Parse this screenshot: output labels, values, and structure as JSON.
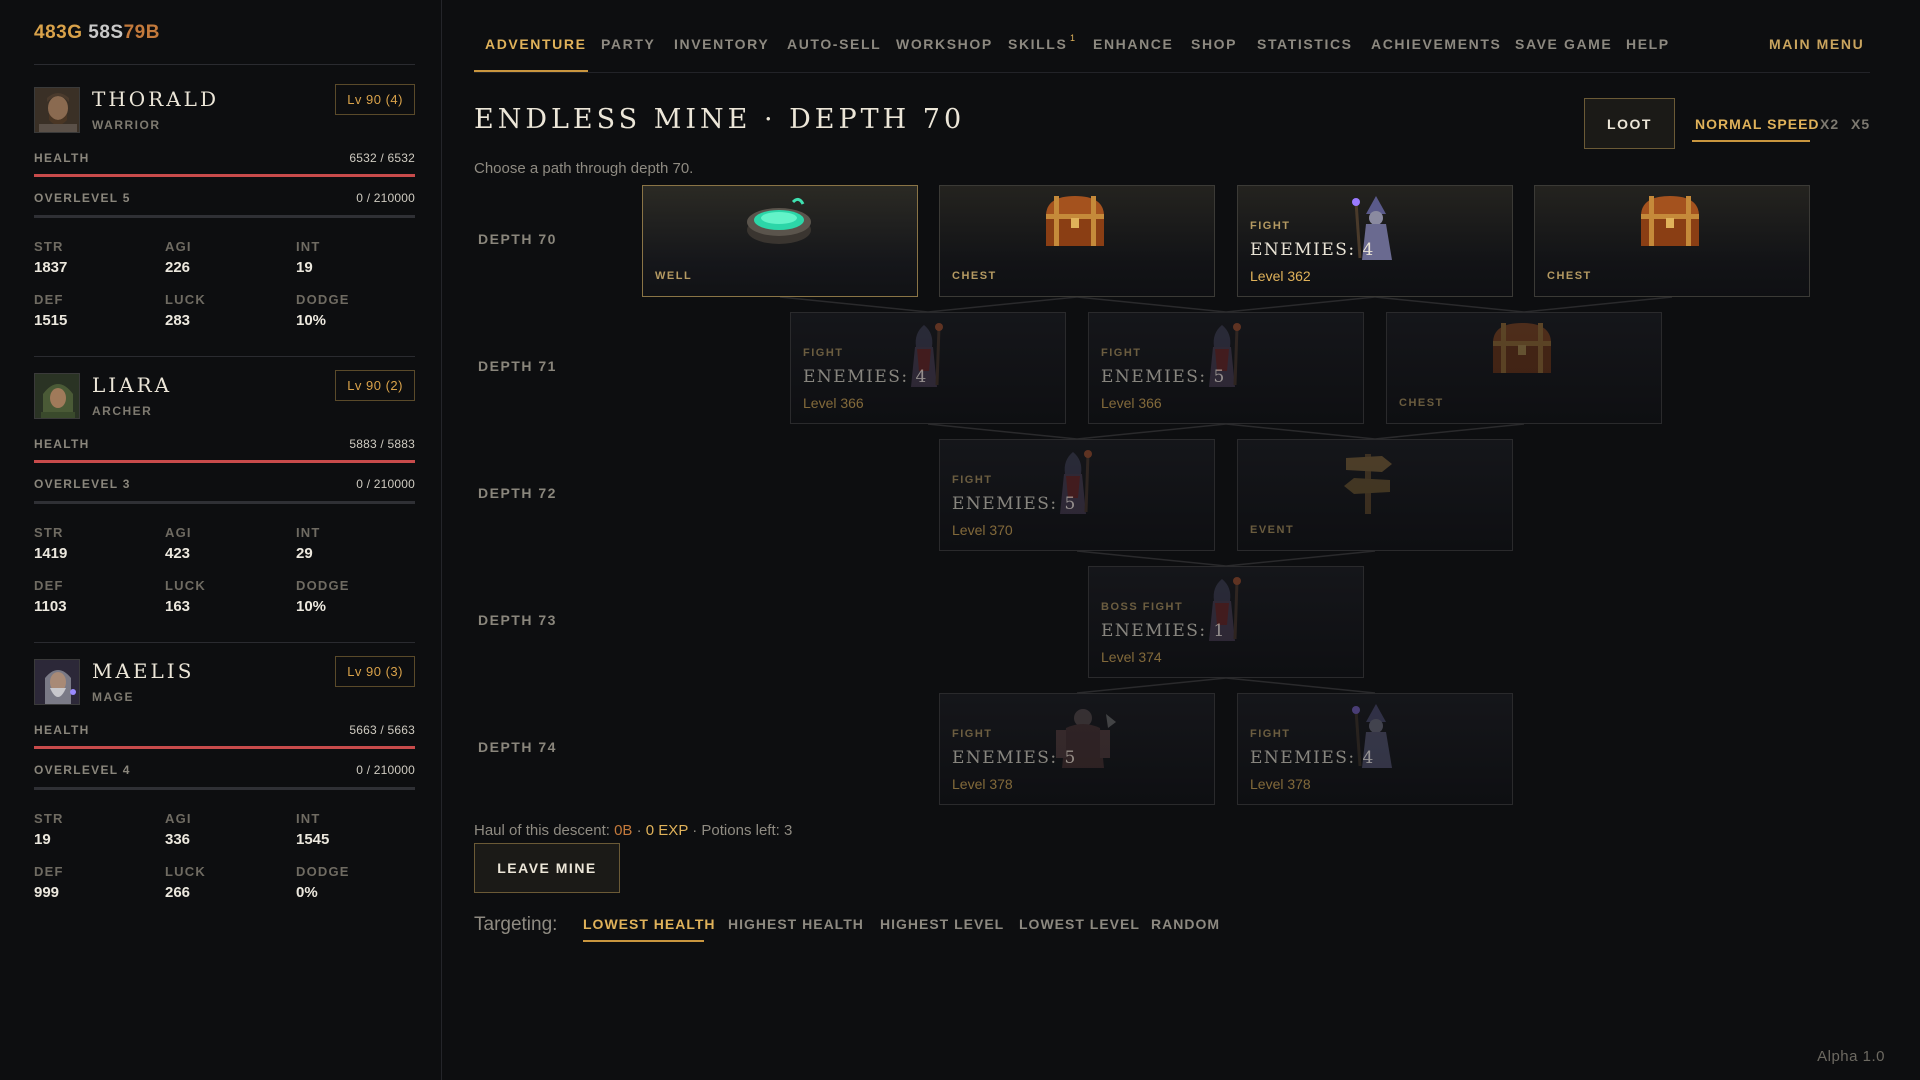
{
  "currency": {
    "gold": "483G",
    "silver": "58S",
    "bronze": "79B"
  },
  "party": [
    {
      "name": "THORALD",
      "class": "WARRIOR",
      "level": "Lv 90 (4)",
      "health_label": "HEALTH",
      "health": "6532 / 6532",
      "health_fraction": 1.0,
      "overlevel_label": "OVERLEVEL 5",
      "overlevel": "0 / 210000",
      "stats": [
        {
          "label": "STR",
          "value": "1837"
        },
        {
          "label": "AGI",
          "value": "226"
        },
        {
          "label": "INT",
          "value": "19"
        },
        {
          "label": "DEF",
          "value": "1515"
        },
        {
          "label": "LUCK",
          "value": "283"
        },
        {
          "label": "DODGE",
          "value": "10%"
        }
      ]
    },
    {
      "name": "LIARA",
      "class": "ARCHER",
      "level": "Lv 90 (2)",
      "health_label": "HEALTH",
      "health": "5883 / 5883",
      "health_fraction": 1.0,
      "overlevel_label": "OVERLEVEL 3",
      "overlevel": "0 / 210000",
      "stats": [
        {
          "label": "STR",
          "value": "1419"
        },
        {
          "label": "AGI",
          "value": "423"
        },
        {
          "label": "INT",
          "value": "29"
        },
        {
          "label": "DEF",
          "value": "1103"
        },
        {
          "label": "LUCK",
          "value": "163"
        },
        {
          "label": "DODGE",
          "value": "10%"
        }
      ]
    },
    {
      "name": "MAELIS",
      "class": "MAGE",
      "level": "Lv 90 (3)",
      "health_label": "HEALTH",
      "health": "5663 / 5663",
      "health_fraction": 1.0,
      "overlevel_label": "OVERLEVEL 4",
      "overlevel": "0 / 210000",
      "stats": [
        {
          "label": "STR",
          "value": "19"
        },
        {
          "label": "AGI",
          "value": "336"
        },
        {
          "label": "INT",
          "value": "1545"
        },
        {
          "label": "DEF",
          "value": "999"
        },
        {
          "label": "LUCK",
          "value": "266"
        },
        {
          "label": "DODGE",
          "value": "0%"
        }
      ]
    }
  ],
  "nav": {
    "tabs": [
      "ADVENTURE",
      "PARTY",
      "INVENTORY",
      "AUTO-SELL",
      "WORKSHOP",
      "SKILLS",
      "ENHANCE",
      "SHOP",
      "STATISTICS",
      "ACHIEVEMENTS",
      "SAVE GAME",
      "HELP"
    ],
    "skills_badge": "1",
    "active_tab": "ADVENTURE",
    "main_menu": "MAIN MENU"
  },
  "mine": {
    "title": "ENDLESS MINE · DEPTH 70",
    "subtitle": "Choose a path through depth 70.",
    "loot_button": "LOOT",
    "speeds": [
      "NORMAL SPEED",
      "X2",
      "X5"
    ],
    "active_speed": "NORMAL SPEED",
    "depths": [
      {
        "label": "DEPTH 70",
        "nodes": [
          {
            "type": "WELL",
            "art": "well-icon",
            "state": "sel"
          },
          {
            "type": "CHEST",
            "art": "chest-icon",
            "state": "avail"
          },
          {
            "type": "FIGHT",
            "main": "ENEMIES: 4",
            "level": "Level 362",
            "art": "mage-enemy-icon",
            "state": "avail"
          },
          {
            "type": "CHEST",
            "art": "chest-icon",
            "state": "avail"
          }
        ]
      },
      {
        "label": "DEPTH 71",
        "nodes": [
          {
            "type": "FIGHT",
            "main": "ENEMIES: 4",
            "level": "Level 366",
            "art": "cultist-enemy-icon",
            "state": "dim"
          },
          {
            "type": "FIGHT",
            "main": "ENEMIES: 5",
            "level": "Level 366",
            "art": "cultist-enemy-icon",
            "state": "dim"
          },
          {
            "type": "CHEST",
            "art": "chest-icon",
            "state": "dim"
          }
        ]
      },
      {
        "label": "DEPTH 72",
        "nodes": [
          {
            "type": "FIGHT",
            "main": "ENEMIES: 5",
            "level": "Level 370",
            "art": "cultist-enemy-icon",
            "state": "dim"
          },
          {
            "type": "EVENT",
            "art": "signpost-icon",
            "state": "dim"
          }
        ]
      },
      {
        "label": "DEPTH 73",
        "nodes": [
          {
            "type": "BOSS FIGHT",
            "main": "ENEMIES: 1",
            "level": "Level 374",
            "art": "cultist-enemy-icon",
            "state": "dim"
          }
        ]
      },
      {
        "label": "DEPTH 74",
        "nodes": [
          {
            "type": "FIGHT",
            "main": "ENEMIES: 5",
            "level": "Level 378",
            "art": "brute-enemy-icon",
            "state": "dim"
          },
          {
            "type": "FIGHT",
            "main": "ENEMIES: 4",
            "level": "Level 378",
            "art": "mage-enemy-icon",
            "state": "dim"
          }
        ]
      }
    ],
    "haul_prefix": "Haul of this descent:",
    "haul_bronze": "0B",
    "haul_exp": "0 EXP",
    "haul_potions": "Potions left: 3",
    "leave_button": "LEAVE MINE"
  },
  "targeting": {
    "label": "Targeting:",
    "options": [
      "LOWEST HEALTH",
      "HIGHEST HEALTH",
      "HIGHEST LEVEL",
      "LOWEST LEVEL",
      "RANDOM"
    ],
    "active": "LOWEST HEALTH"
  },
  "version": "Alpha 1.0",
  "colors": {
    "accent": "#e0b25a",
    "health": "#c84b4b",
    "bronze": "#c47a3c",
    "background": "#0d0e10"
  }
}
